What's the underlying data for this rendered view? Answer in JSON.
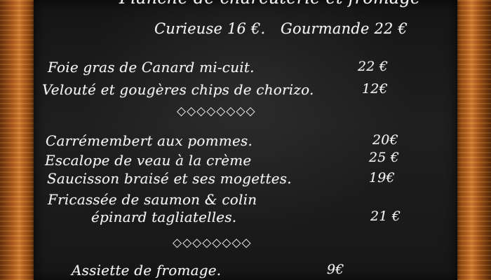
{
  "menu": {
    "header": "Planche de charcuterie et fromage",
    "formulas": [
      {
        "name": "Curieuse 16 €."
      },
      {
        "name": "Gourmande 22 €"
      }
    ],
    "starters": [
      {
        "name": "Foie gras de Canard mi-cuit.",
        "price": "22 €"
      },
      {
        "name": "Velouté et gougères chips de chorizo.",
        "price": "12€"
      }
    ],
    "separator": "◇◇◇◇◇◇◇◇",
    "mains": [
      {
        "name": "Carrémembert aux pommes.",
        "price": "20€"
      },
      {
        "name": "Escalope de veau à la crème",
        "price": "25 €"
      },
      {
        "name": "Saucisson braisé et ses mogettes.",
        "price": "19€"
      },
      {
        "name": "Fricassée de saumon & colin",
        "price": "21 €"
      },
      {
        "name": "épinard tagliatelles."
      }
    ],
    "cheese": {
      "name": "Assiette de fromage.",
      "price": "9€"
    }
  },
  "colors": {
    "chalk": "#f4f4f4",
    "board": "#1b1b1b",
    "wood": "#b8631f"
  }
}
